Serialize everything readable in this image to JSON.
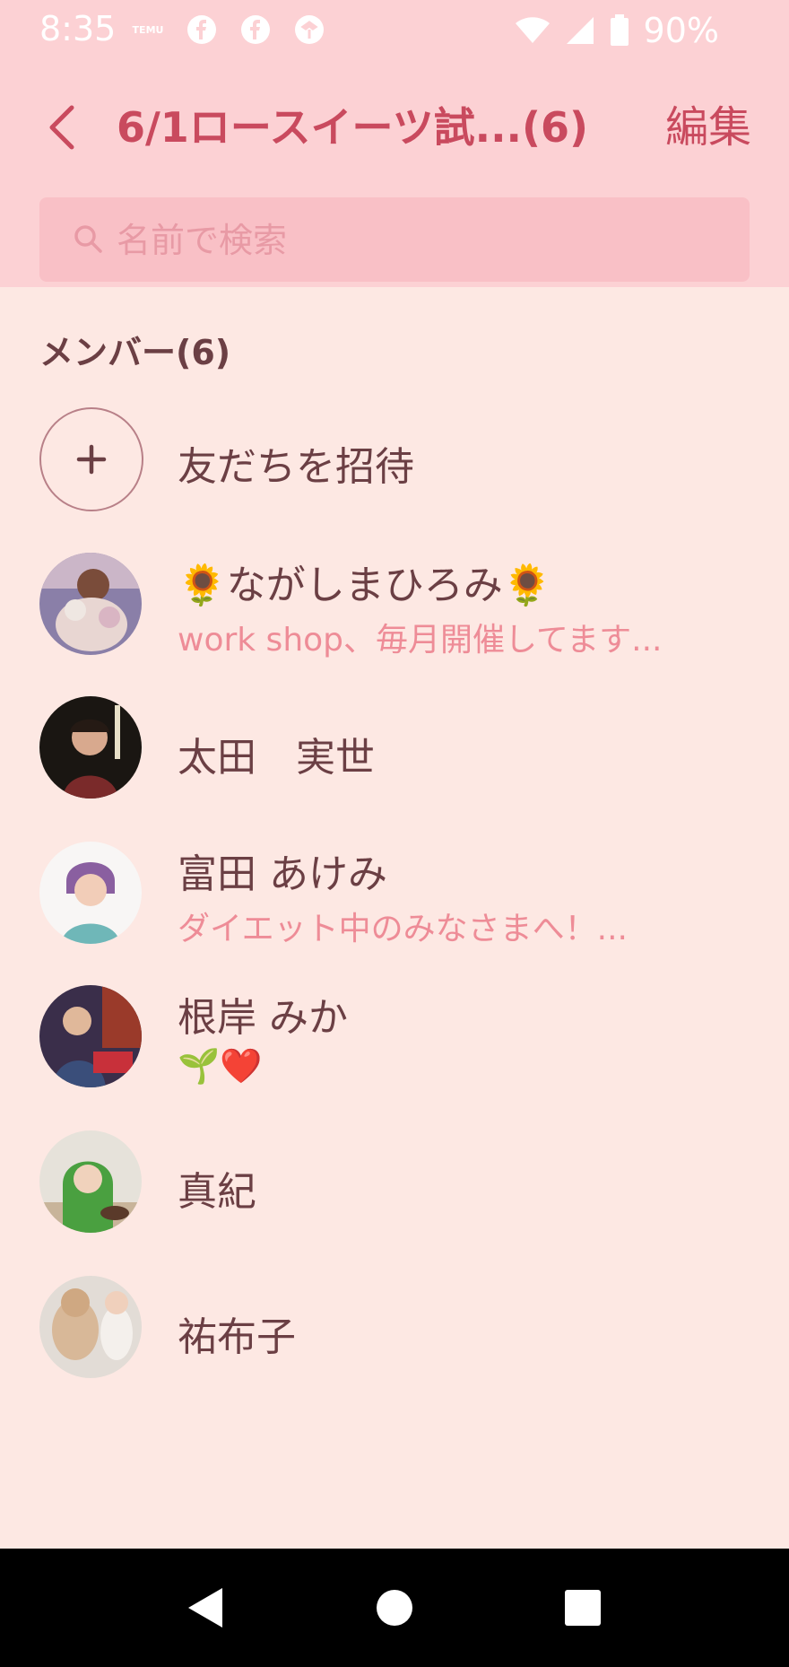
{
  "status_bar": {
    "time": "8:35",
    "temu_label": "TEMU",
    "battery": "90%"
  },
  "header": {
    "title": "6/1ロースイーツ試...(6)",
    "edit_label": "編集"
  },
  "search": {
    "placeholder": "名前で検索"
  },
  "members": {
    "section_title": "メンバー(6)",
    "invite_label": "友だちを招待",
    "list": [
      {
        "name": "🌻ながしまひろみ🌻",
        "status": "work shop、毎月開催してます..."
      },
      {
        "name": "太田　実世",
        "status": ""
      },
      {
        "name": "富田 あけみ",
        "status": "ダイエット中のみなさまへ！..."
      },
      {
        "name": "根岸 みか",
        "status": "🌱❤️"
      },
      {
        "name": "真紀",
        "status": ""
      },
      {
        "name": "祐布子",
        "status": ""
      }
    ]
  },
  "colors": {
    "header_bg": "#fcd1d4",
    "page_bg": "#fde8e3",
    "accent": "#c94a5e",
    "status_text": "#ee8c97"
  }
}
